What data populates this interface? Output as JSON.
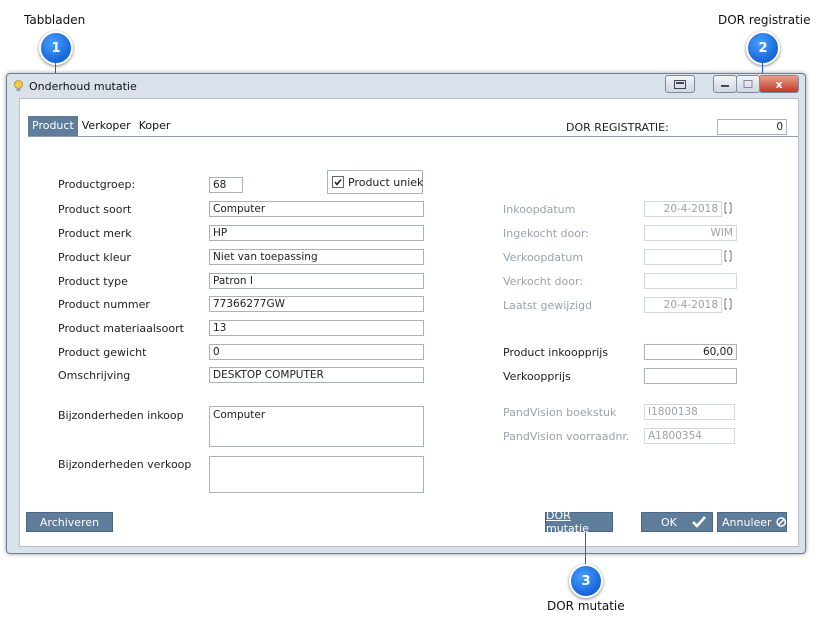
{
  "callouts": [
    {
      "number": "1",
      "text": "Tabbladen"
    },
    {
      "number": "2",
      "text": "DOR registratie"
    },
    {
      "number": "3",
      "text": "DOR mutatie"
    }
  ],
  "window": {
    "title": "Onderhoud mutatie",
    "close_glyph": "x"
  },
  "tabs": [
    {
      "label": "Product"
    },
    {
      "label": "Verkoper"
    },
    {
      "label": "Koper"
    }
  ],
  "dor_registratie": {
    "label": "DOR REGISTRATIE:",
    "value": "0"
  },
  "product_uniek": {
    "label": "Product uniek",
    "checked": true
  },
  "left_fields": [
    {
      "label": "Productgroep:",
      "value": "68"
    },
    {
      "label": "Product soort",
      "value": "Computer"
    },
    {
      "label": "Product merk",
      "value": "HP"
    },
    {
      "label": "Product kleur",
      "value": "Niet van toepassing"
    },
    {
      "label": "Product type",
      "value": "Patron I"
    },
    {
      "label": "Product nummer",
      "value": "77366277GW"
    },
    {
      "label": "Product materiaalsoort",
      "value": "13"
    },
    {
      "label": "Product gewicht",
      "value": "0"
    },
    {
      "label": "Omschrijving",
      "value": "DESKTOP COMPUTER"
    }
  ],
  "bijz_inkoop": {
    "label": "Bijzonderheden inkoop",
    "value": "Computer"
  },
  "bijz_verkoop": {
    "label": "Bijzonderheden verkoop",
    "value": ""
  },
  "right_fields": [
    {
      "label": "Inkoopdatum",
      "value": "20-4-2018"
    },
    {
      "label": "Ingekocht door:",
      "value": "WIM"
    },
    {
      "label": "Verkoopdatum",
      "value": ""
    },
    {
      "label": "Verkocht door:",
      "value": ""
    },
    {
      "label": "Laatst gewijzigd",
      "value": "20-4-2018"
    }
  ],
  "prices": [
    {
      "label": "Product inkoopprijs",
      "value": "60,00"
    },
    {
      "label": "Verkoopprijs",
      "value": ""
    }
  ],
  "pandvision": [
    {
      "label": "PandVision boekstuk",
      "value": "I1800138"
    },
    {
      "label": "PandVision voorraadnr.",
      "value": "A1800354"
    }
  ],
  "buttons": {
    "archiveren": "Archiveren",
    "dor_mutatie": "DOR mutatie",
    "ok": "OK",
    "annuleer": "Annuleer"
  },
  "colors": {
    "accent": "#5f7d9a",
    "callout": "#1565d8"
  }
}
